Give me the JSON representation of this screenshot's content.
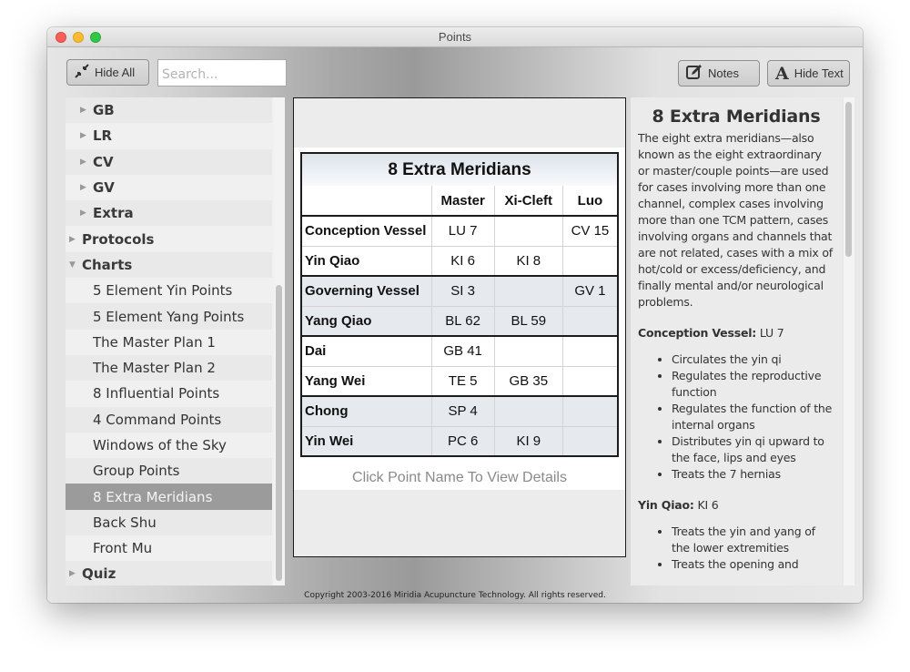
{
  "window": {
    "title": "Points"
  },
  "toolbar": {
    "hide_all_label": "Hide All",
    "search_placeholder": "Search...",
    "search_value": "",
    "notes_label": "Notes",
    "hide_text_label": "Hide Text"
  },
  "sidebar": {
    "items": [
      {
        "label": "GB",
        "level": "sub-bold",
        "caret": "▶"
      },
      {
        "label": "LR",
        "level": "sub-bold",
        "caret": "▶"
      },
      {
        "label": "CV",
        "level": "sub-bold",
        "caret": "▶"
      },
      {
        "label": "GV",
        "level": "sub-bold",
        "caret": "▶"
      },
      {
        "label": "Extra",
        "level": "sub-bold",
        "caret": "▶"
      },
      {
        "label": "Protocols",
        "level": "top",
        "caret": "▶"
      },
      {
        "label": "Charts",
        "level": "top",
        "caret": "▼"
      },
      {
        "label": "5 Element Yin Points",
        "level": "leaf"
      },
      {
        "label": "5 Element Yang Points",
        "level": "leaf"
      },
      {
        "label": "The Master Plan 1",
        "level": "leaf"
      },
      {
        "label": "The Master Plan 2",
        "level": "leaf"
      },
      {
        "label": "8 Influential Points",
        "level": "leaf"
      },
      {
        "label": "4 Command Points",
        "level": "leaf"
      },
      {
        "label": "Windows of the Sky",
        "level": "leaf"
      },
      {
        "label": "Group Points",
        "level": "leaf"
      },
      {
        "label": "8 Extra Meridians",
        "level": "leaf",
        "selected": true
      },
      {
        "label": "Back Shu",
        "level": "leaf"
      },
      {
        "label": "Front Mu",
        "level": "leaf"
      },
      {
        "label": "Quiz",
        "level": "top",
        "caret": "▶"
      }
    ]
  },
  "chart": {
    "title": "8 Extra Meridians",
    "columns": [
      "",
      "Master",
      "Xi-Cleft",
      "Luo"
    ],
    "rows": [
      {
        "name": "Conception Vessel",
        "master": "LU 7",
        "xi_cleft": "",
        "luo": "CV 15"
      },
      {
        "name": "Yin Qiao",
        "master": "KI 6",
        "xi_cleft": "KI 8",
        "luo": ""
      },
      {
        "name": "Governing Vessel",
        "master": "SI 3",
        "xi_cleft": "",
        "luo": "GV 1"
      },
      {
        "name": "Yang Qiao",
        "master": "BL 62",
        "xi_cleft": "BL 59",
        "luo": ""
      },
      {
        "name": "Dai",
        "master": "GB 41",
        "xi_cleft": "",
        "luo": ""
      },
      {
        "name": "Yang Wei",
        "master": "TE 5",
        "xi_cleft": "GB 35",
        "luo": ""
      },
      {
        "name": "Chong",
        "master": "SP 4",
        "xi_cleft": "",
        "luo": ""
      },
      {
        "name": "Yin Wei",
        "master": "PC 6",
        "xi_cleft": "KI 9",
        "luo": ""
      }
    ],
    "hint": "Click Point Name To View Details"
  },
  "details": {
    "title": "8 Extra Meridians",
    "intro": "The eight extra meridians—also known as the eight extraordinary or master/couple points—are used for cases involving more than one channel, complex cases involving more than one TCM pattern, cases involving organs and channels that are not related, cases with a mix of hot/cold or excess/deficiency, and finally mental and/or neurological problems.",
    "sections": [
      {
        "label": "Conception Vessel:",
        "point": " LU 7",
        "bullets": [
          "Circulates the yin qi",
          "Regulates the reproductive function",
          "Regulates the function of the internal organs",
          "Distributes yin qi upward to the face, lips and eyes",
          "Treats the 7 hernias"
        ]
      },
      {
        "label": "Yin Qiao:",
        "point": " KI 6",
        "bullets": [
          "Treats the yin and yang of the lower extremities",
          "Treats the opening and"
        ]
      }
    ]
  },
  "footer": {
    "copyright": "Copyright 2003-2016 Miridia Acupuncture Technology.  All rights reserved."
  }
}
